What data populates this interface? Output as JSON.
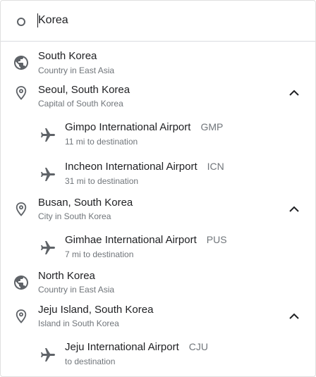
{
  "search": {
    "value": "Korea"
  },
  "results": [
    {
      "kind": "country",
      "icon": "globe-icon",
      "title": "South Korea",
      "subtitle": "Country in East Asia"
    },
    {
      "kind": "city",
      "icon": "location-pin-icon",
      "title": "Seoul, South Korea",
      "subtitle": "Capital of South Korea",
      "expanded": true,
      "airports": [
        {
          "icon": "airplane-icon",
          "name": "Gimpo International Airport",
          "code": "GMP",
          "distance": "11 mi to destination"
        },
        {
          "icon": "airplane-icon",
          "name": "Incheon International Airport",
          "code": "ICN",
          "distance": "31 mi to destination"
        }
      ]
    },
    {
      "kind": "city",
      "icon": "location-pin-icon",
      "title": "Busan, South Korea",
      "subtitle": "City in South Korea",
      "expanded": true,
      "airports": [
        {
          "icon": "airplane-icon",
          "name": "Gimhae International Airport",
          "code": "PUS",
          "distance": "7 mi to destination"
        }
      ]
    },
    {
      "kind": "country",
      "icon": "globe-icon",
      "title": "North Korea",
      "subtitle": "Country in East Asia"
    },
    {
      "kind": "city",
      "icon": "location-pin-icon",
      "title": "Jeju Island, South Korea",
      "subtitle": "Island in South Korea",
      "expanded": true,
      "airports": [
        {
          "icon": "airplane-icon",
          "name": "Jeju International Airport",
          "code": "CJU",
          "distance": "to destination"
        }
      ]
    }
  ],
  "colors": {
    "primary_text": "#202124",
    "secondary_text": "#70757a",
    "icon": "#5f6368",
    "divider": "#dadce0"
  }
}
